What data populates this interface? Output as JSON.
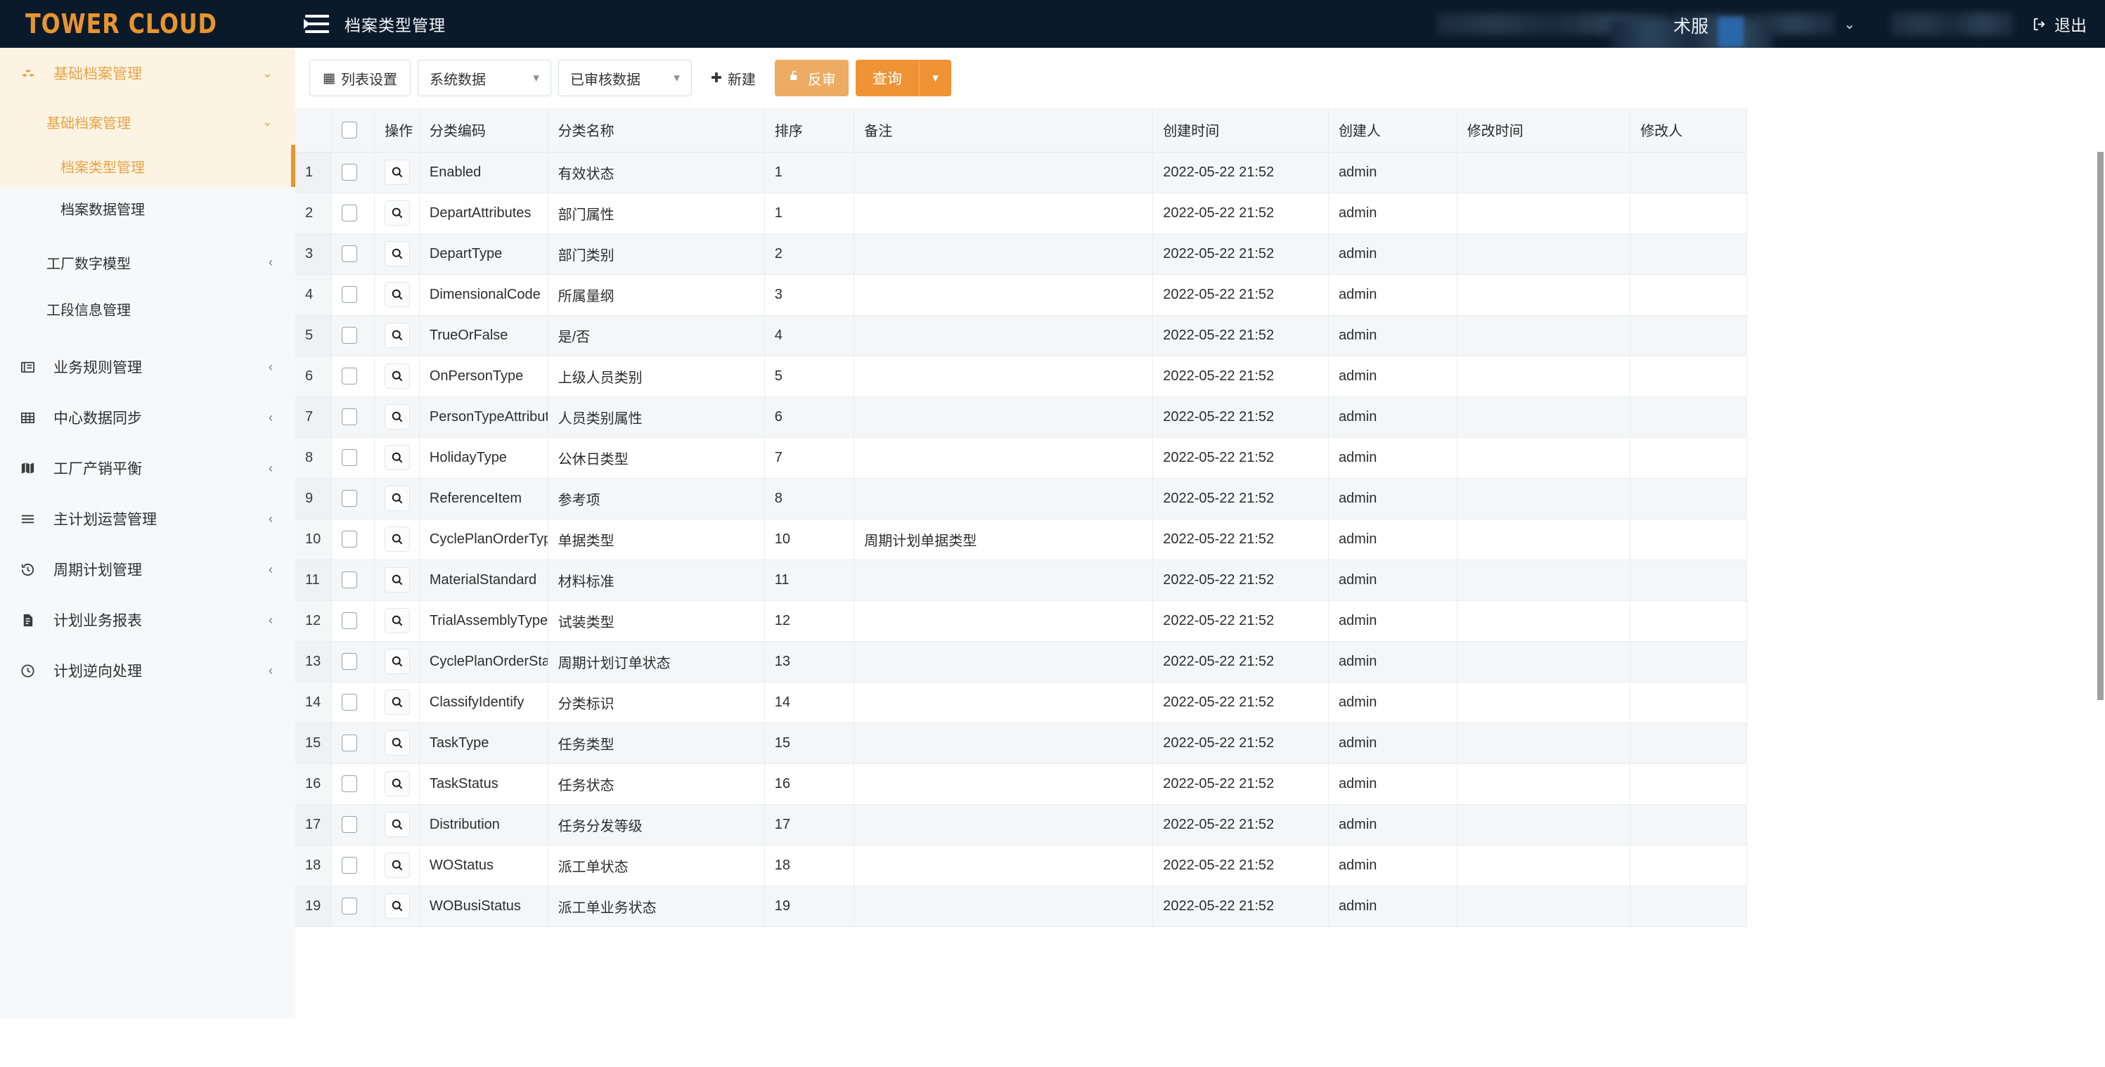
{
  "app": {
    "logo": "TOWER CLOUD",
    "logo_color": "#e8952f",
    "topbar_bg": "#0b1a2b",
    "page_title": "档案类型管理",
    "menu_icon": "hamburger-icon",
    "partial_text": "术服",
    "logout_label": "退出",
    "chevron": "⌄"
  },
  "sidebar": {
    "group": {
      "label": "基础档案管理",
      "icon": "boxes-icon",
      "caret": "⌄"
    },
    "subgroup": {
      "label": "基础档案管理",
      "caret": "⌄"
    },
    "children": [
      {
        "label": "档案类型管理",
        "active": true
      },
      {
        "label": "档案数据管理",
        "active": false
      }
    ],
    "siblings": [
      {
        "label": "工厂数字模型",
        "caret": "‹"
      },
      {
        "label": "工段信息管理",
        "caret": ""
      }
    ],
    "items": [
      {
        "label": "业务规则管理",
        "icon": "book-icon",
        "caret": "‹"
      },
      {
        "label": "中心数据同步",
        "icon": "table-icon",
        "caret": "‹"
      },
      {
        "label": "工厂产销平衡",
        "icon": "map-icon",
        "caret": "‹"
      },
      {
        "label": "主计划运营管理",
        "icon": "list-icon",
        "caret": "‹"
      },
      {
        "label": "周期计划管理",
        "icon": "history-icon",
        "caret": "‹"
      },
      {
        "label": "计划业务报表",
        "icon": "report-icon",
        "caret": "‹"
      },
      {
        "label": "计划逆向处理",
        "icon": "clock-icon",
        "caret": "‹"
      }
    ]
  },
  "toolbar": {
    "list_settings": "列表设置",
    "list_settings_icon": "grid-icon",
    "select_source": "系统数据",
    "select_status": "已审核数据",
    "new_label": "新建",
    "new_icon": "plus-icon",
    "unaudit_label": "反审",
    "unaudit_icon": "unlock-icon",
    "query_label": "查询",
    "query_caret": "▼",
    "colors": {
      "unaudit_bg": "#edab63",
      "query_bg": "#ef9335",
      "accent": "#e8952f"
    }
  },
  "table": {
    "columns": [
      {
        "key": "idx",
        "label": ""
      },
      {
        "key": "chk",
        "label": ""
      },
      {
        "key": "act",
        "label": "操作"
      },
      {
        "key": "code",
        "label": "分类编码"
      },
      {
        "key": "name",
        "label": "分类名称"
      },
      {
        "key": "sort",
        "label": "排序"
      },
      {
        "key": "remark",
        "label": "备注"
      },
      {
        "key": "created_at",
        "label": "创建时间"
      },
      {
        "key": "created_by",
        "label": "创建人"
      },
      {
        "key": "modified_at",
        "label": "修改时间"
      },
      {
        "key": "modified_by",
        "label": "修改人"
      }
    ],
    "action_icon": "search-icon",
    "header_checkbox": "select-all-checkbox",
    "rows": [
      {
        "idx": "1",
        "code": "Enabled",
        "name": "有效状态",
        "sort": "1",
        "remark": "",
        "created_at": "2022-05-22 21:52",
        "created_by": "admin",
        "modified_at": "",
        "modified_by": ""
      },
      {
        "idx": "2",
        "code": "DepartAttributes",
        "name": "部门属性",
        "sort": "1",
        "remark": "",
        "created_at": "2022-05-22 21:52",
        "created_by": "admin",
        "modified_at": "",
        "modified_by": ""
      },
      {
        "idx": "3",
        "code": "DepartType",
        "name": "部门类别",
        "sort": "2",
        "remark": "",
        "created_at": "2022-05-22 21:52",
        "created_by": "admin",
        "modified_at": "",
        "modified_by": ""
      },
      {
        "idx": "4",
        "code": "DimensionalCode",
        "name": "所属量纲",
        "sort": "3",
        "remark": "",
        "created_at": "2022-05-22 21:52",
        "created_by": "admin",
        "modified_at": "",
        "modified_by": ""
      },
      {
        "idx": "5",
        "code": "TrueOrFalse",
        "name": "是/否",
        "sort": "4",
        "remark": "",
        "created_at": "2022-05-22 21:52",
        "created_by": "admin",
        "modified_at": "",
        "modified_by": ""
      },
      {
        "idx": "6",
        "code": "OnPersonType",
        "name": "上级人员类别",
        "sort": "5",
        "remark": "",
        "created_at": "2022-05-22 21:52",
        "created_by": "admin",
        "modified_at": "",
        "modified_by": ""
      },
      {
        "idx": "7",
        "code": "PersonTypeAttributes",
        "name": "人员类别属性",
        "sort": "6",
        "remark": "",
        "created_at": "2022-05-22 21:52",
        "created_by": "admin",
        "modified_at": "",
        "modified_by": ""
      },
      {
        "idx": "8",
        "code": "HolidayType",
        "name": "公休日类型",
        "sort": "7",
        "remark": "",
        "created_at": "2022-05-22 21:52",
        "created_by": "admin",
        "modified_at": "",
        "modified_by": ""
      },
      {
        "idx": "9",
        "code": "ReferenceItem",
        "name": "参考项",
        "sort": "8",
        "remark": "",
        "created_at": "2022-05-22 21:52",
        "created_by": "admin",
        "modified_at": "",
        "modified_by": ""
      },
      {
        "idx": "10",
        "code": "CyclePlanOrderType",
        "name": "单据类型",
        "sort": "10",
        "remark": "周期计划单据类型",
        "created_at": "2022-05-22 21:52",
        "created_by": "admin",
        "modified_at": "",
        "modified_by": ""
      },
      {
        "idx": "11",
        "code": "MaterialStandard",
        "name": "材料标准",
        "sort": "11",
        "remark": "",
        "created_at": "2022-05-22 21:52",
        "created_by": "admin",
        "modified_at": "",
        "modified_by": ""
      },
      {
        "idx": "12",
        "code": "TrialAssemblyType",
        "name": "试装类型",
        "sort": "12",
        "remark": "",
        "created_at": "2022-05-22 21:52",
        "created_by": "admin",
        "modified_at": "",
        "modified_by": ""
      },
      {
        "idx": "13",
        "code": "CyclePlanOrderStatus",
        "name": "周期计划订单状态",
        "sort": "13",
        "remark": "",
        "created_at": "2022-05-22 21:52",
        "created_by": "admin",
        "modified_at": "",
        "modified_by": ""
      },
      {
        "idx": "14",
        "code": "ClassifyIdentify",
        "name": "分类标识",
        "sort": "14",
        "remark": "",
        "created_at": "2022-05-22 21:52",
        "created_by": "admin",
        "modified_at": "",
        "modified_by": ""
      },
      {
        "idx": "15",
        "code": "TaskType",
        "name": "任务类型",
        "sort": "15",
        "remark": "",
        "created_at": "2022-05-22 21:52",
        "created_by": "admin",
        "modified_at": "",
        "modified_by": ""
      },
      {
        "idx": "16",
        "code": "TaskStatus",
        "name": "任务状态",
        "sort": "16",
        "remark": "",
        "created_at": "2022-05-22 21:52",
        "created_by": "admin",
        "modified_at": "",
        "modified_by": ""
      },
      {
        "idx": "17",
        "code": "Distribution",
        "name": "任务分发等级",
        "sort": "17",
        "remark": "",
        "created_at": "2022-05-22 21:52",
        "created_by": "admin",
        "modified_at": "",
        "modified_by": ""
      },
      {
        "idx": "18",
        "code": "WOStatus",
        "name": "派工单状态",
        "sort": "18",
        "remark": "",
        "created_at": "2022-05-22 21:52",
        "created_by": "admin",
        "modified_at": "",
        "modified_by": ""
      },
      {
        "idx": "19",
        "code": "WOBusiStatus",
        "name": "派工单业务状态",
        "sort": "19",
        "remark": "",
        "created_at": "2022-05-22 21:52",
        "created_by": "admin",
        "modified_at": "",
        "modified_by": ""
      }
    ]
  }
}
